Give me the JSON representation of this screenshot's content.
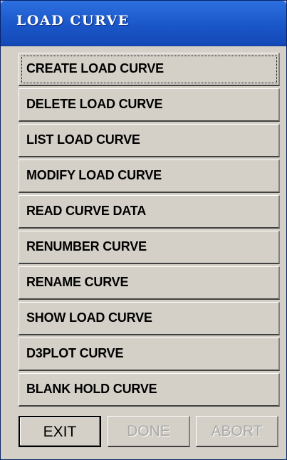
{
  "window": {
    "title": "LOAD CURVE"
  },
  "menu": {
    "items": [
      {
        "label": "CREATE LOAD CURVE",
        "focused": true
      },
      {
        "label": "DELETE LOAD CURVE"
      },
      {
        "label": "LIST LOAD CURVE"
      },
      {
        "label": "MODIFY LOAD CURVE"
      },
      {
        "label": "READ CURVE DATA"
      },
      {
        "label": "RENUMBER CURVE"
      },
      {
        "label": "RENAME CURVE"
      },
      {
        "label": "SHOW LOAD CURVE"
      },
      {
        "label": "D3PLOT CURVE"
      },
      {
        "label": "BLANK HOLD CURVE"
      }
    ]
  },
  "buttons": {
    "exit": {
      "label": "EXIT",
      "enabled": true
    },
    "done": {
      "label": "DONE",
      "enabled": false
    },
    "abort": {
      "label": "ABORT",
      "enabled": false
    }
  },
  "colors": {
    "title_bar": "#1a56c8",
    "face": "#d4d0c8",
    "disabled_text": "#a8a8a8"
  }
}
